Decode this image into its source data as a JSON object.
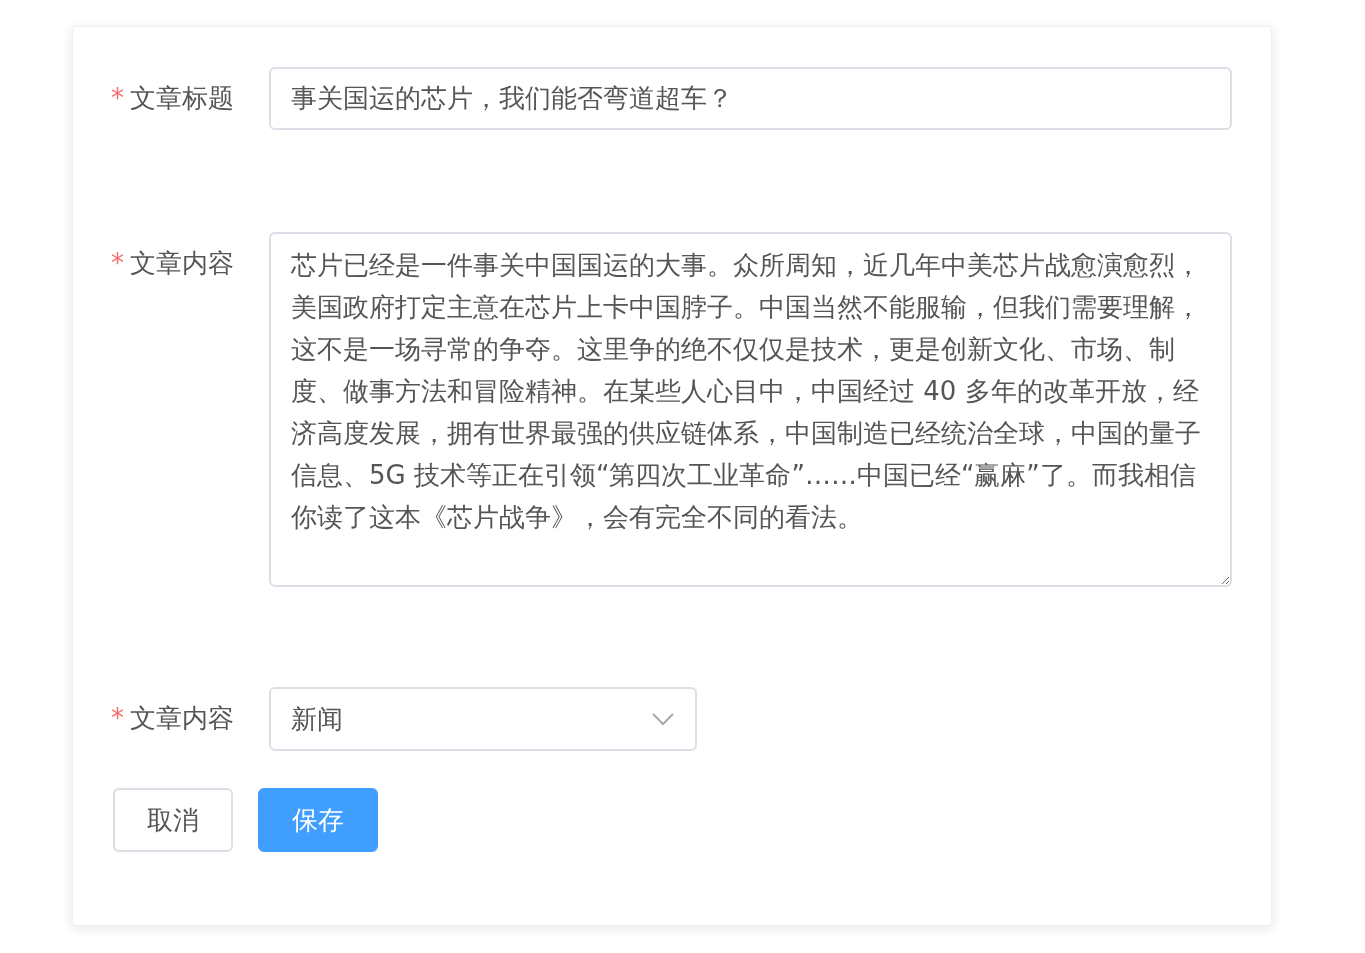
{
  "form": {
    "fields": [
      {
        "kind": "input",
        "required_mark": "*",
        "label": "文章标题",
        "value": "事关国运的芯片，我们能否弯道超车？"
      },
      {
        "kind": "textarea",
        "required_mark": "*",
        "label": "文章内容",
        "value": "芯片已经是一件事关中国国运的大事。众所周知，近几年中美芯片战愈演愈烈，美国政府打定主意在芯片上卡中国脖子。中国当然不能服输，但我们需要理解，这不是一场寻常的争夺。这里争的绝不仅仅是技术，更是创新文化、市场、制度、做事方法和冒险精神。在某些人心目中，中国经过 40 多年的改革开放，经济高度发展，拥有世界最强的供应链体系，中国制造已经统治全球，中国的量子信息、5G 技术等正在引领“第四次工业革命”……中国已经“赢麻”了。而我相信你读了这本《芯片战争》，会有完全不同的看法。"
      },
      {
        "kind": "select",
        "required_mark": "*",
        "label": "文章内容",
        "value": "新闻"
      }
    ],
    "buttons": [
      {
        "kind": "default",
        "label": "取消"
      },
      {
        "kind": "primary",
        "label": "保存"
      }
    ]
  }
}
